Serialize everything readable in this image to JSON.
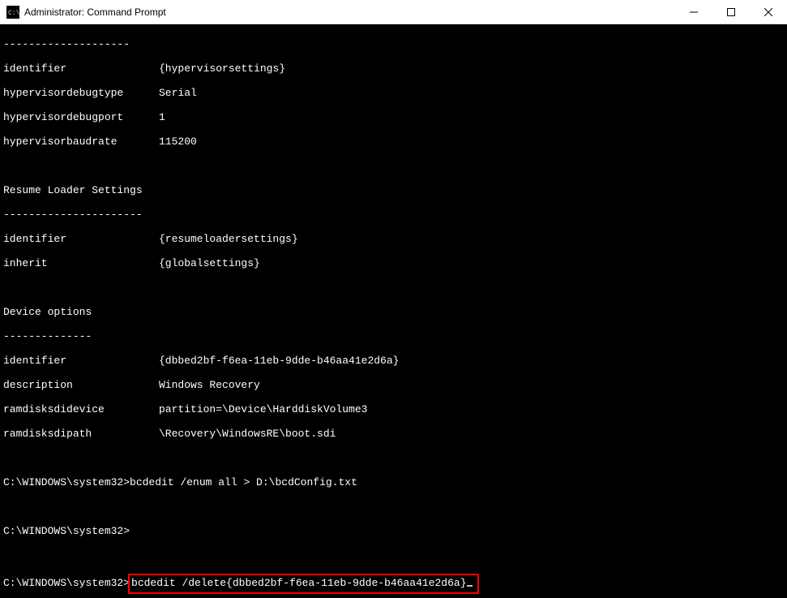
{
  "window": {
    "title": "Administrator: Command Prompt"
  },
  "sections": {
    "hypervisor": {
      "dashes_top": "--------------------",
      "identifier_key": "identifier",
      "identifier_val": "{hypervisorsettings}",
      "debugtype_key": "hypervisordebugtype",
      "debugtype_val": "Serial",
      "debugport_key": "hypervisordebugport",
      "debugport_val": "1",
      "baudrate_key": "hypervisorbaudrate",
      "baudrate_val": "115200"
    },
    "resume": {
      "header": "Resume Loader Settings",
      "dashes": "----------------------",
      "identifier_key": "identifier",
      "identifier_val": "{resumeloadersettings}",
      "inherit_key": "inherit",
      "inherit_val": "{globalsettings}"
    },
    "device": {
      "header": "Device options",
      "dashes": "--------------",
      "identifier_key": "identifier",
      "identifier_val": "{dbbed2bf-f6ea-11eb-9dde-b46aa41e2d6a}",
      "description_key": "description",
      "description_val": "Windows Recovery",
      "sdidevice_key": "ramdisksdidevice",
      "sdidevice_val": "partition=\\Device\\HarddiskVolume3",
      "sdipath_key": "ramdisksdipath",
      "sdipath_val": "\\Recovery\\WindowsRE\\boot.sdi"
    }
  },
  "prompts": {
    "p1_prefix": "C:\\WINDOWS\\system32>",
    "p1_cmd": "bcdedit /enum all > D:\\bcdConfig.txt",
    "p2_prefix": "C:\\WINDOWS\\system32>",
    "p3_prefix": "C:\\WINDOWS\\system32>",
    "p3_cmd": "bcdedit /delete{dbbed2bf-f6ea-11eb-9dde-b46aa41e2d6a}"
  }
}
